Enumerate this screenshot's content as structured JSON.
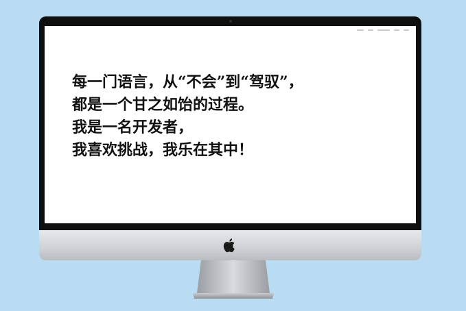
{
  "screen_text": {
    "line1": "每一门语言，从“不会”到“驾驭”，",
    "line2": "都是一个甘之如饴的过程。",
    "line3": "我是一名开发者，",
    "line4": "我喜欢挑战，我乐在其中！"
  },
  "icons": {
    "logo": "apple-logo-icon",
    "camera": "camera-icon"
  },
  "colors": {
    "background": "#b9dcf3",
    "bezel": "#0f0f10",
    "screen": "#ffffff",
    "text": "#111111"
  }
}
